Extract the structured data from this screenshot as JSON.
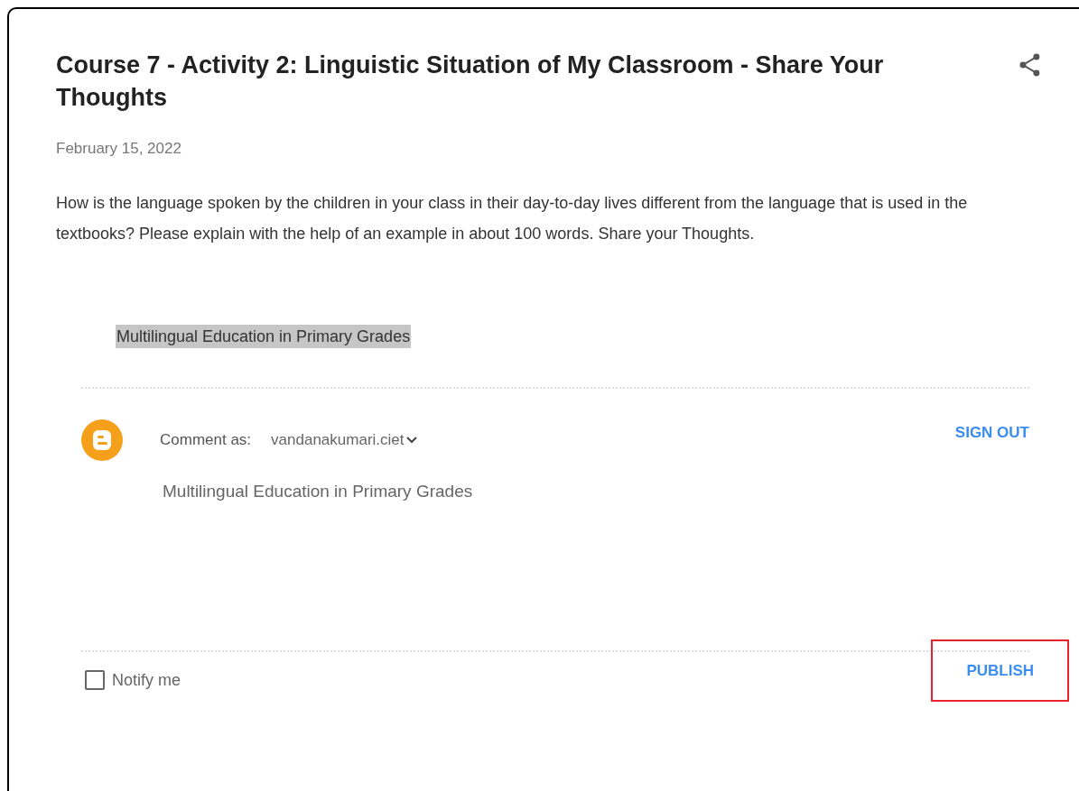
{
  "post": {
    "title": "Course 7 - Activity 2: Linguistic Situation of My Classroom - Share Your Thoughts",
    "date": "February 15, 2022",
    "body": "How is the language spoken by the children in your class in their day-to-day lives different from the language that is used in the textbooks? Please explain with the help of an example in about 100 words. Share your Thoughts.",
    "highlighted_text": "Multilingual Education in Primary Grades"
  },
  "comment_form": {
    "comment_as_label": "Comment as:",
    "account": "vandanakumari.ciet",
    "sign_out": "SIGN OUT",
    "comment_text": "Multilingual Education in Primary Grades",
    "notify": {
      "label": "Notify me",
      "checked": false
    },
    "publish": {
      "label": "PUBLISH",
      "highlighted": true
    }
  }
}
